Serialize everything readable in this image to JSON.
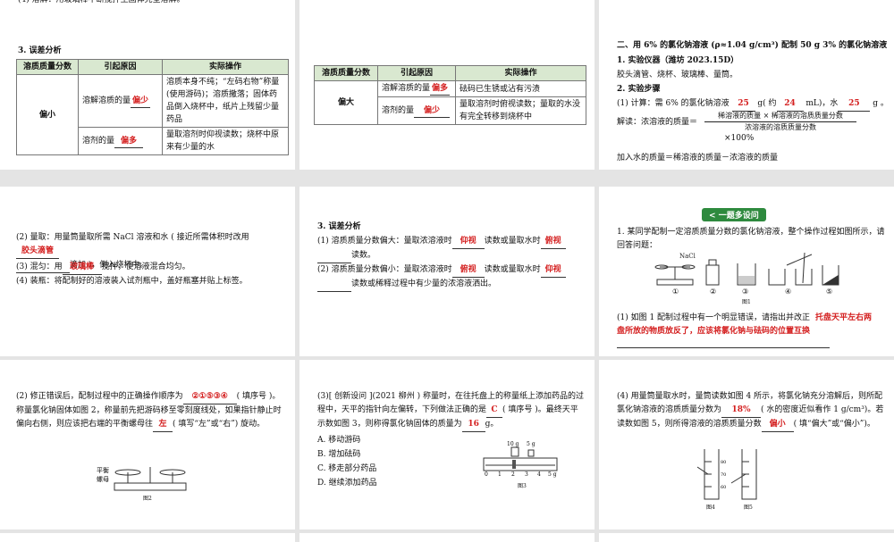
{
  "s1": {
    "top_text": "(4) 溶解：用玻璃棒不断搅拌至固体完全溶解。"
  },
  "s2": {
    "heading": "3. 误差分析",
    "headers": [
      "溶质质量分数",
      "引起原因",
      "实际操作"
    ],
    "group": "偏小",
    "r1_cause": "溶解溶质的量",
    "r1_ans": "偏少",
    "r1_action": "溶质本身不纯；“左码右物”称量(使用游码)；溶质撒落；固体药品倒入烧杯中，纸片上残留少量药品",
    "r2_cause": "溶剂的量",
    "r2_ans": "偏多",
    "r2_action": "量取溶剂时仰视读数；烧杯中原来有少量的水"
  },
  "s3": {
    "headers": [
      "溶质质量分数",
      "引起原因",
      "实际操作"
    ],
    "group": "偏大",
    "r1_cause": "溶解溶质的量",
    "r1_ans": "偏多",
    "r1_action": "砝码已生锈或沾有污渍",
    "r2_cause": "溶剂的量",
    "r2_ans": "偏少",
    "r2_action": "量取溶剂时俯视读数；量取的水没有完全转移到烧杯中"
  },
  "s4": {
    "title": "二、用 6% 的氯化钠溶液 (ρ≈1.04 g/cm³) 配制 50 g 3% 的氯化钠溶液",
    "step1": "1. 实验仪器（潍坊 2023.15D）",
    "instruments": "胶头滴管、烧杯、玻璃棒、量筒。",
    "step2": "2. 实验步骤",
    "calc_a": "(1) 计算：需 6% 的氯化钠溶液",
    "ans1": "25",
    "calc_b": "g( 约",
    "ans2": "24",
    "calc_c": "mL)，水",
    "ans3": "25",
    "calc_d": "g 。",
    "explain": "解读：浓溶液的质量＝",
    "frac_num": "稀溶液的质量 × 稀溶液的溶质质量分数",
    "frac_den": "浓溶液的溶质质量分数",
    "frac_pct": "×100%",
    "water": "加入水的质量＝稀溶液的质量－浓溶液的质量"
  },
  "s5": {
    "l1a": "(2) 量取：用量筒量取所需 NaCl 溶液和水 ( 接近所需体积时改用",
    "ans1": "胶头滴管",
    "l1b": "滴加 )，倒入烧杯中。",
    "l2a": "(3) 混匀：用",
    "ans2": "玻璃棒",
    "l2b": "搅拌，使溶液混合均匀。",
    "l3": "(4) 装瓶：将配制好的溶液装入试剂瓶中，盖好瓶塞并贴上标签。"
  },
  "s6": {
    "heading": "3. 误差分析",
    "l1a": "(1) 溶质质量分数偏大：量取浓溶液时",
    "ans1": "仰视",
    "l1b": "读数或量取水时",
    "ans2": "俯视",
    "l1c": "读数。",
    "l2a": "(2) 溶质质量分数偏小：量取浓溶液时",
    "ans3": "俯视",
    "l2b": "读数或量取水时",
    "ans4": "仰视",
    "l2c": "读数或稀释过程中有少量的浓溶液洒出。"
  },
  "s7": {
    "badge": "一题多设问",
    "q": "1. 某同学配制一定溶质质量分数的氯化钠溶液，整个操作过程如图所示，请回答问题：",
    "nacl": "NaCl",
    "nums": [
      "①",
      "②",
      "③",
      "④",
      "⑤"
    ],
    "fig": "图1",
    "q1": "(1) 如图 1 配制过程中有一个明显错误，请指出并改正",
    "ans1": "托盘天平左右两盘所放的物质放反了，应该将氯化钠与砝码的位置互换"
  },
  "s8": {
    "t1": "(2) 修正错误后，配制过程中的正确操作顺序为",
    "ans1": "②①⑤③④",
    "t2": "( 填序号 )。称量氯化钠固体如图 2，称量前先把游码移至零刻度线处，如果指针静止时偏向右侧，则应该把右端的平衡螺母往",
    "ans2": "左",
    "t3": "( 填写“左”或“右”) 旋动。",
    "lbl1": "平衡",
    "lbl2": "螺母",
    "fig": "图2"
  },
  "s9": {
    "t1": "(3)[ 创新设问 ](2021 柳州 ) 称量时，在往托盘上的称量纸上添加药品的过程中，天平的指针向左偏转，下列做法正确的是",
    "ans1": "C",
    "t2": "( 填序号 )。最终天平示数如图 3，则称得氯化钠固体的质量为",
    "ans2": "16",
    "t3": "g。",
    "opts": [
      "A. 移动游码",
      "B. 增加砝码",
      "C. 移走部分药品",
      "D. 继续添加药品"
    ],
    "w1": "10 g",
    "w2": "5 g",
    "ticks": [
      "0",
      "1",
      "2",
      "3",
      "4",
      "5 g"
    ],
    "fig": "图3"
  },
  "s10": {
    "t1": "(4) 用量筒量取水时，量筒读数如图 4 所示，将氯化钠充分溶解后，则所配氯化钠溶液的溶质质量分数为",
    "ans1": "18%",
    "t2": "( 水的密度近似看作 1 g/cm³)。若读数如图 5，则所得溶液的溶质质量分数",
    "ans2": "偏小",
    "t3": "( 填“偏大”或“偏小”)。",
    "cyl_marks": [
      "80",
      "70",
      "60"
    ],
    "fig4": "图4",
    "fig5": "图5"
  }
}
